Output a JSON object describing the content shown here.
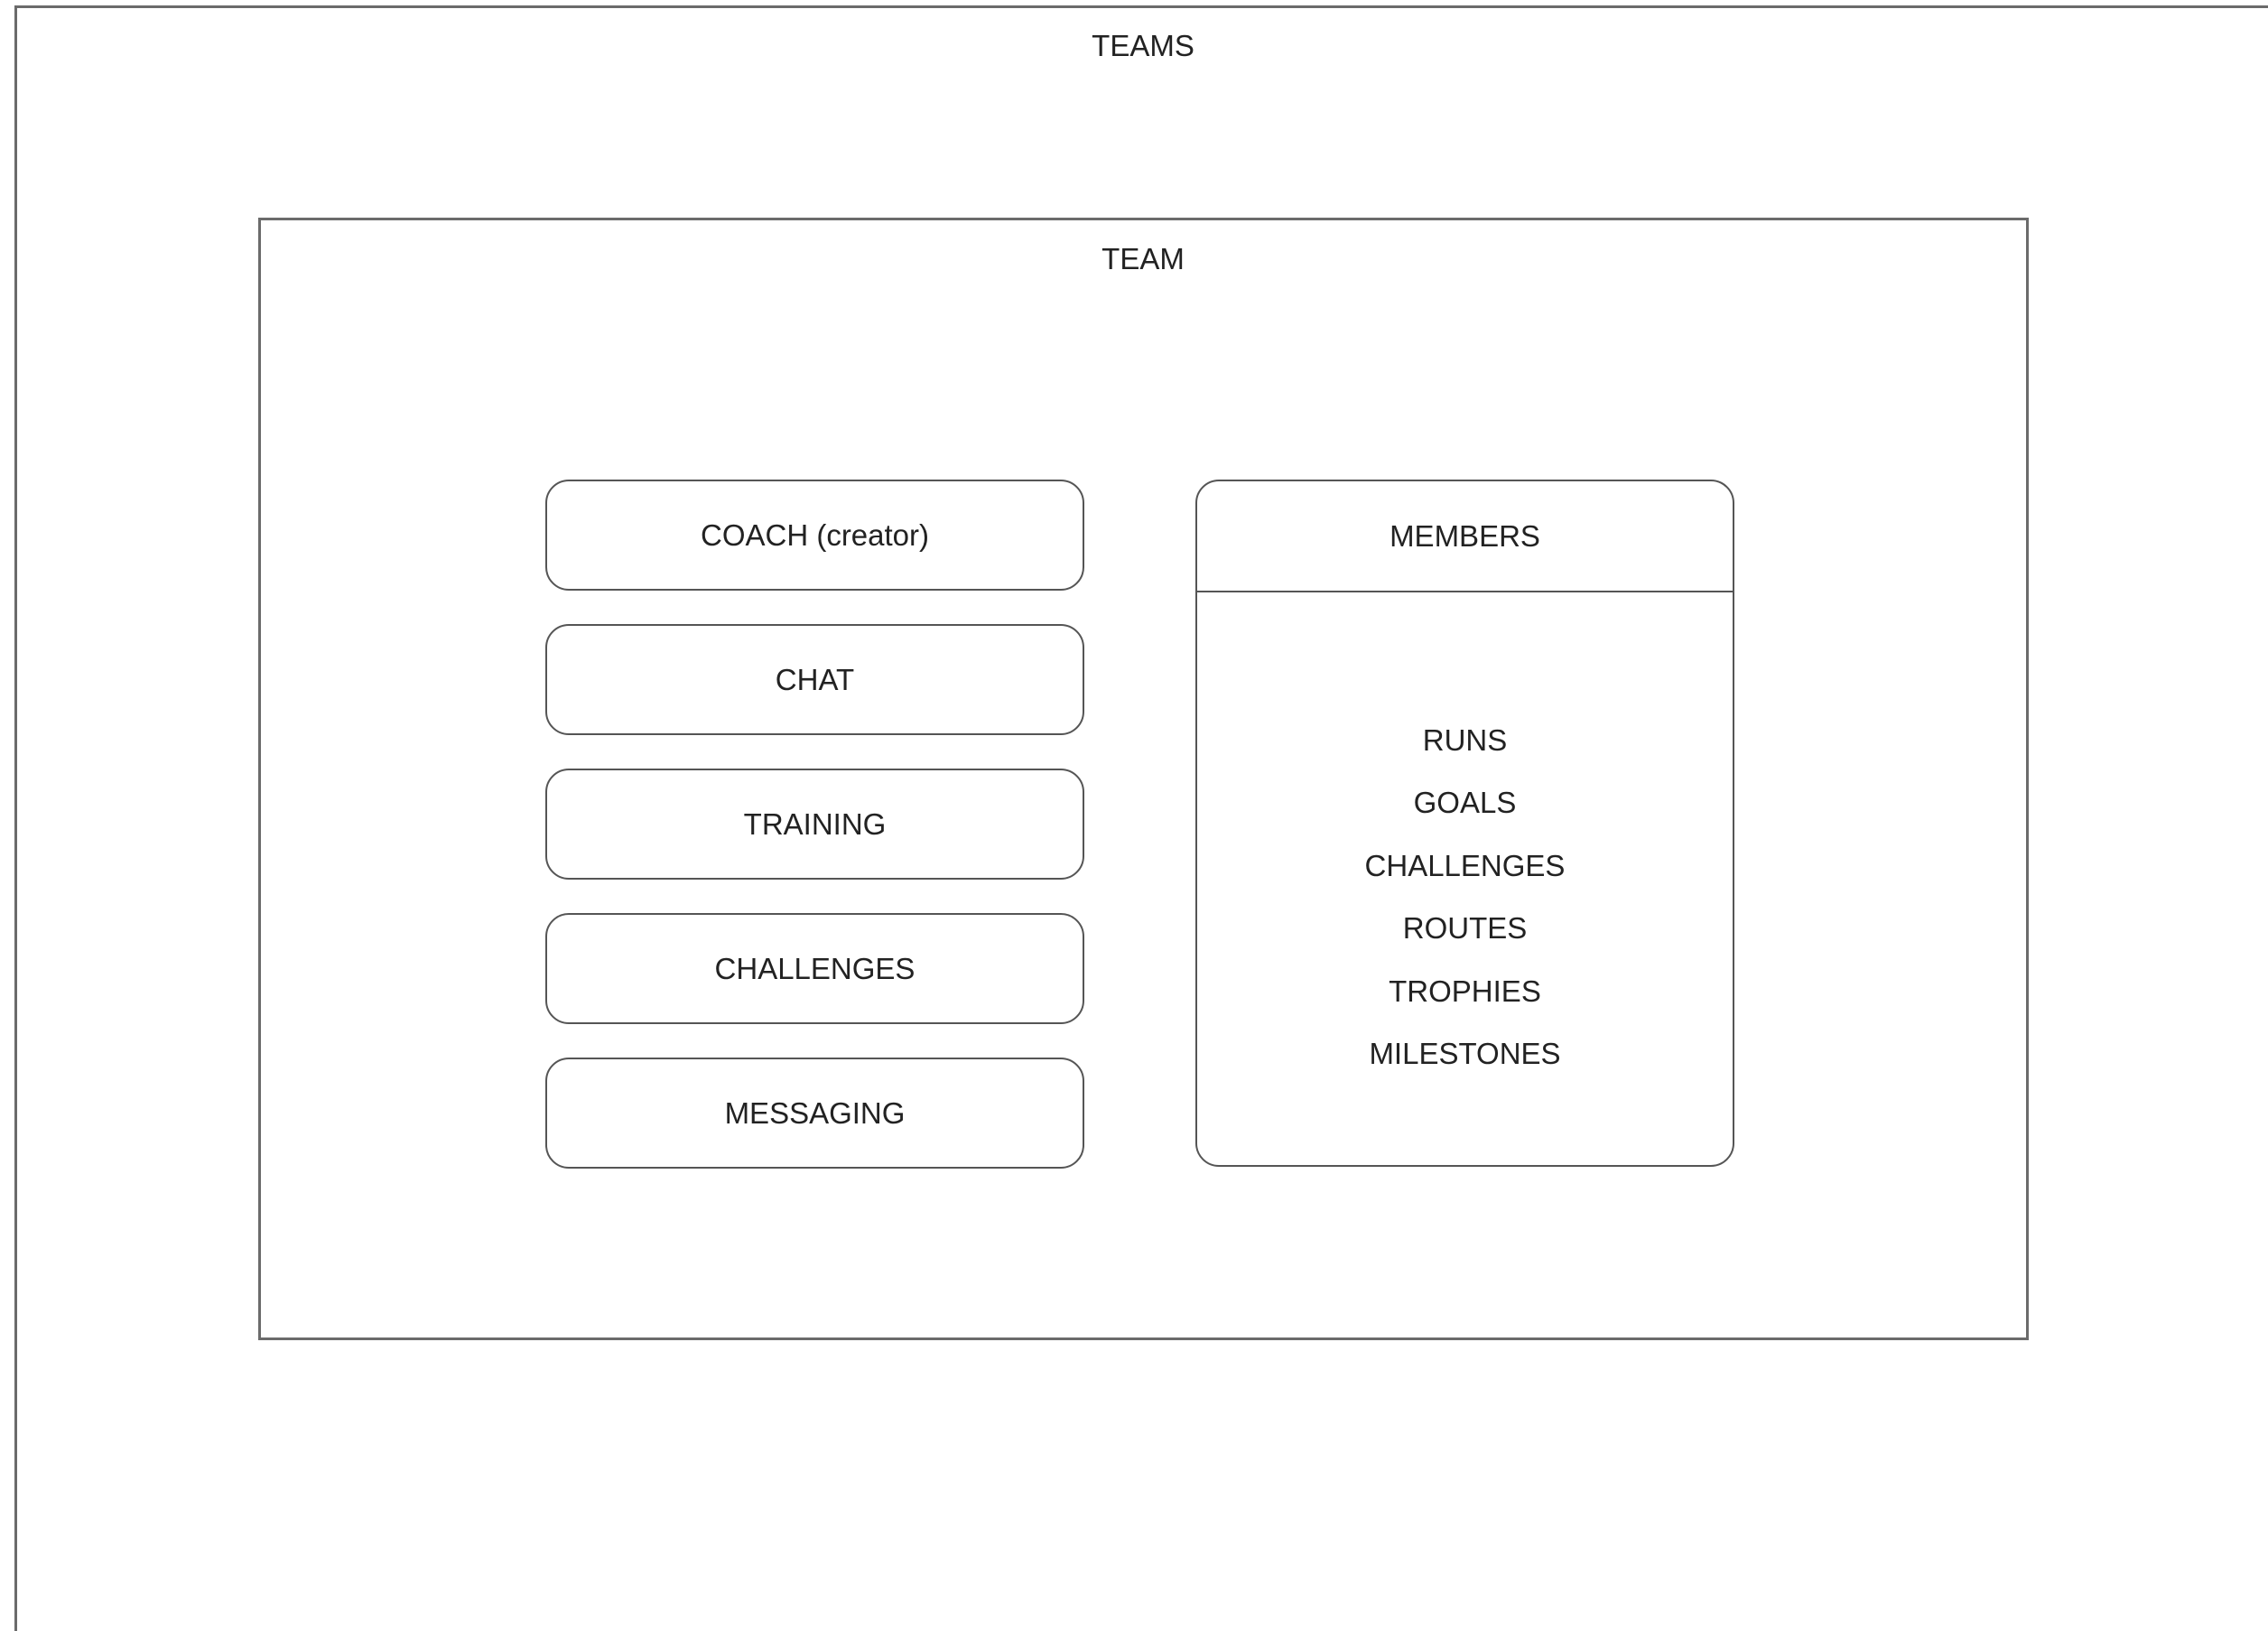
{
  "teams": {
    "title": "TEAMS"
  },
  "team": {
    "title": "TEAM",
    "features": [
      {
        "label": "COACH (creator)"
      },
      {
        "label": "CHAT"
      },
      {
        "label": "TRAINING"
      },
      {
        "label": "CHALLENGES"
      },
      {
        "label": "MESSAGING"
      }
    ],
    "members": {
      "header": "MEMBERS",
      "items": [
        "RUNS",
        "GOALS",
        "CHALLENGES",
        "ROUTES",
        "TROPHIES",
        "MILESTONES"
      ]
    }
  }
}
